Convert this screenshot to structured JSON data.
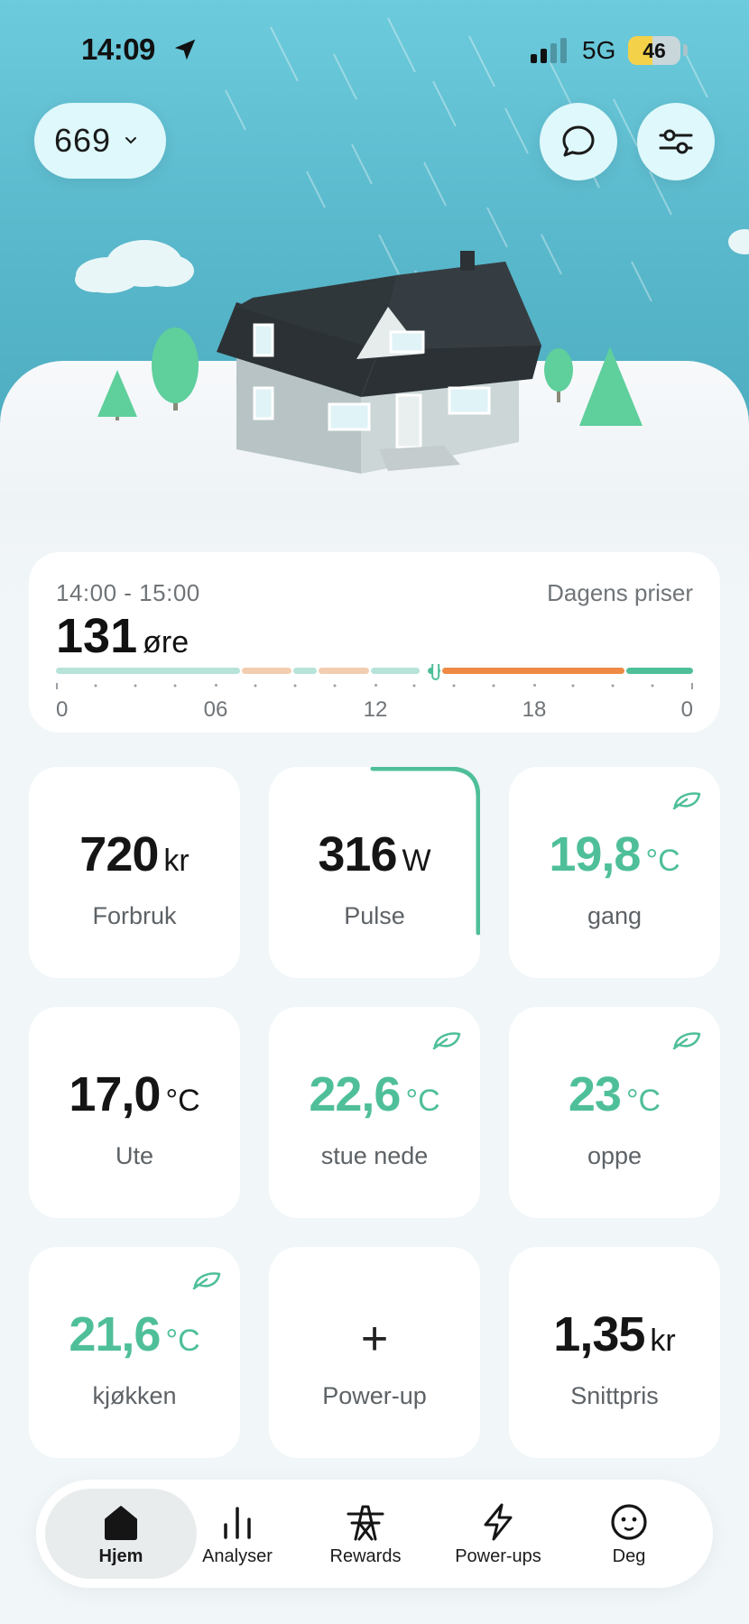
{
  "status_bar": {
    "time": "14:09",
    "network": "5G",
    "battery": "46"
  },
  "header": {
    "home_selector": "669"
  },
  "price": {
    "time_range": "14:00 - 15:00",
    "link_label": "Dagens priser",
    "value": "131",
    "unit": "øre",
    "current_position_hour": 14.3,
    "axis_labels": [
      "00",
      "06",
      "12",
      "18",
      "00"
    ]
  },
  "tiles": [
    {
      "value": "720",
      "unit": "kr",
      "label": "Forbruk"
    },
    {
      "value": "316",
      "unit": "W",
      "label": "Pulse"
    },
    {
      "value": "19,8",
      "unit": "°C",
      "label": "gang"
    },
    {
      "value": "17,0",
      "unit": "°C",
      "label": "Ute"
    },
    {
      "value": "22,6",
      "unit": "°C",
      "label": "stue nede"
    },
    {
      "value": "23",
      "unit": "°C",
      "label": "oppe"
    },
    {
      "value": "21,6",
      "unit": "°C",
      "label": "kjøkken"
    },
    {
      "value": "+",
      "label": "Power-up"
    },
    {
      "value": "1,35",
      "unit": "kr",
      "label": "Snittpris"
    }
  ],
  "nav": {
    "items": [
      {
        "label": "Hjem",
        "icon": "home-icon"
      },
      {
        "label": "Analyser",
        "icon": "bar-chart-icon"
      },
      {
        "label": "Rewards",
        "icon": "power-tower-icon"
      },
      {
        "label": "Power-ups",
        "icon": "lightning-icon"
      },
      {
        "label": "Deg",
        "icon": "face-icon"
      }
    ]
  },
  "colors": {
    "accent_green": "#4fbf9a",
    "price_orange": "#ee8a45",
    "sky": "#5ab9cc"
  }
}
